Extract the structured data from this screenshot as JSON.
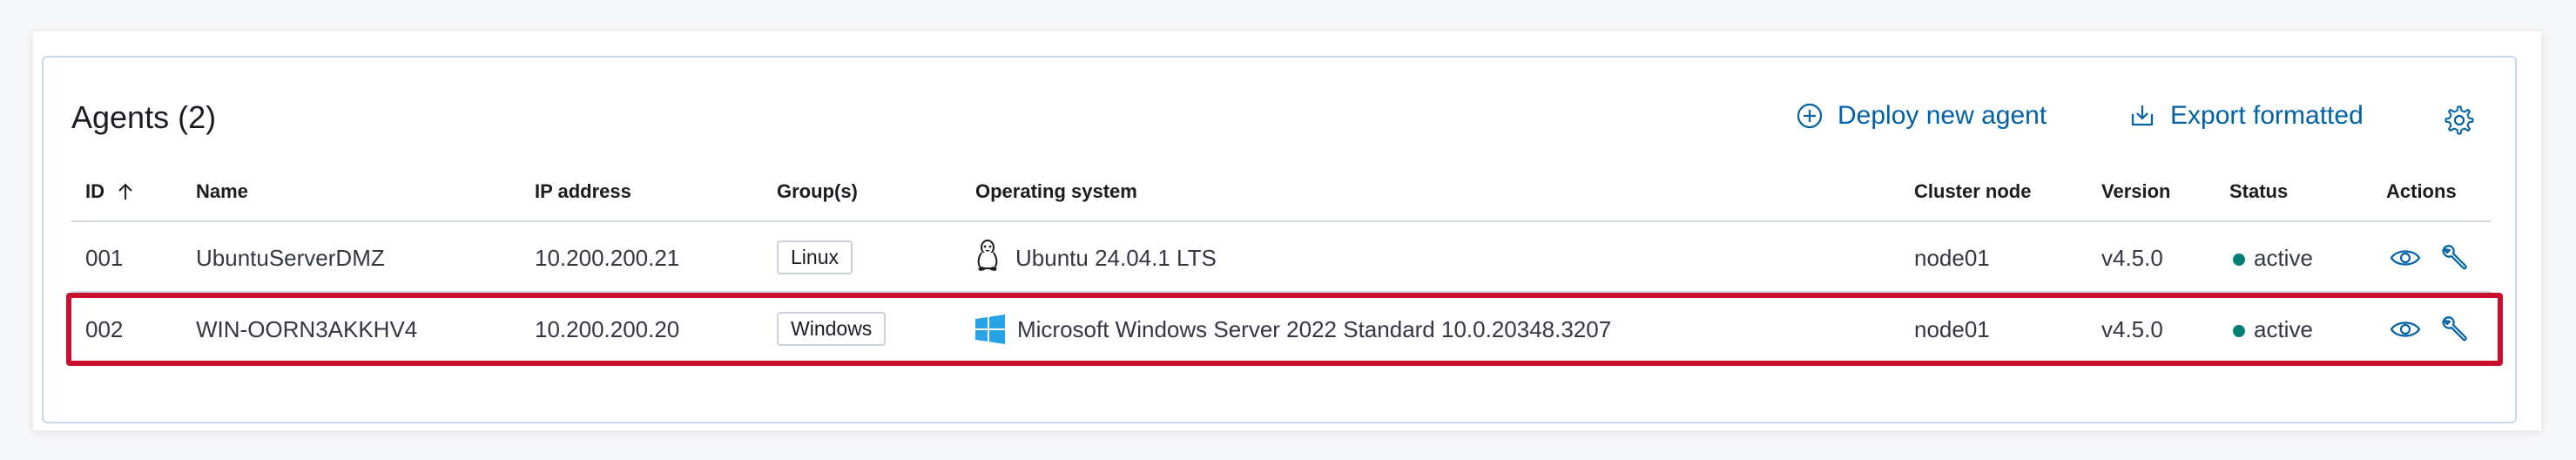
{
  "table": {
    "title": "Agents (2)",
    "deploy_label": "Deploy new agent",
    "export_label": "Export formatted",
    "columns": {
      "id": "ID",
      "name": "Name",
      "ip": "IP address",
      "groups": "Group(s)",
      "os": "Operating system",
      "cluster": "Cluster node",
      "version": "Version",
      "status": "Status",
      "actions": "Actions"
    },
    "rows": [
      {
        "id": "001",
        "name": "UbuntuServerDMZ",
        "ip": "10.200.200.21",
        "group": "Linux",
        "os": "Ubuntu 24.04.1 LTS",
        "os_icon": "linux-tux-icon",
        "cluster": "node01",
        "version": "v4.5.0",
        "status": "active"
      },
      {
        "id": "002",
        "name": "WIN-OORN3AKKHV4",
        "ip": "10.200.200.20",
        "group": "Windows",
        "os": "Microsoft Windows Server 2022 Standard 10.0.20348.3207",
        "os_icon": "windows-logo-icon",
        "cluster": "node01",
        "version": "v4.5.0",
        "status": "active",
        "highlighted": true
      }
    ]
  },
  "colors": {
    "accent": "#0061a6",
    "status_active": "#017d73",
    "highlight": "#c8102e",
    "windows_blue": "#29a3e8"
  }
}
